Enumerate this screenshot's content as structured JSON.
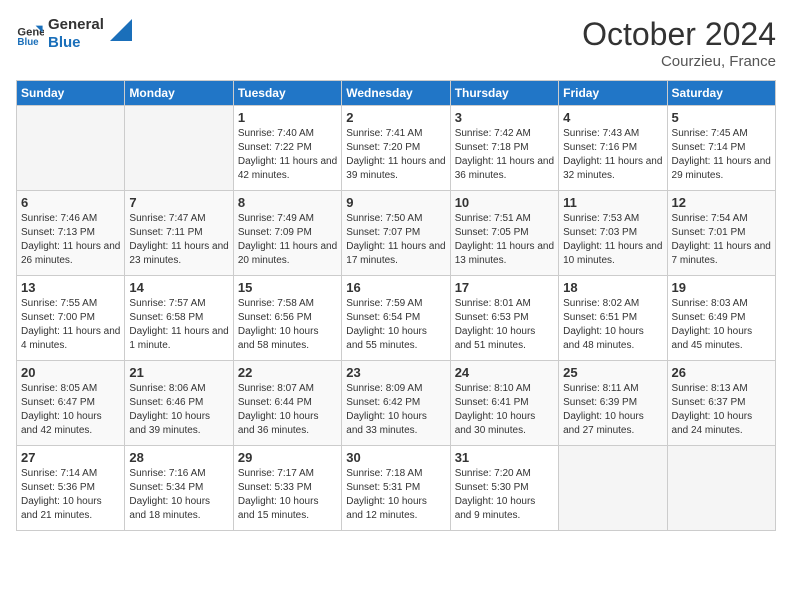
{
  "logo": {
    "line1": "General",
    "line2": "Blue"
  },
  "title": "October 2024",
  "location": "Courzieu, France",
  "weekdays": [
    "Sunday",
    "Monday",
    "Tuesday",
    "Wednesday",
    "Thursday",
    "Friday",
    "Saturday"
  ],
  "weeks": [
    [
      {
        "day": "",
        "sunrise": "",
        "sunset": "",
        "daylight": ""
      },
      {
        "day": "",
        "sunrise": "",
        "sunset": "",
        "daylight": ""
      },
      {
        "day": "1",
        "sunrise": "Sunrise: 7:40 AM",
        "sunset": "Sunset: 7:22 PM",
        "daylight": "Daylight: 11 hours and 42 minutes."
      },
      {
        "day": "2",
        "sunrise": "Sunrise: 7:41 AM",
        "sunset": "Sunset: 7:20 PM",
        "daylight": "Daylight: 11 hours and 39 minutes."
      },
      {
        "day": "3",
        "sunrise": "Sunrise: 7:42 AM",
        "sunset": "Sunset: 7:18 PM",
        "daylight": "Daylight: 11 hours and 36 minutes."
      },
      {
        "day": "4",
        "sunrise": "Sunrise: 7:43 AM",
        "sunset": "Sunset: 7:16 PM",
        "daylight": "Daylight: 11 hours and 32 minutes."
      },
      {
        "day": "5",
        "sunrise": "Sunrise: 7:45 AM",
        "sunset": "Sunset: 7:14 PM",
        "daylight": "Daylight: 11 hours and 29 minutes."
      }
    ],
    [
      {
        "day": "6",
        "sunrise": "Sunrise: 7:46 AM",
        "sunset": "Sunset: 7:13 PM",
        "daylight": "Daylight: 11 hours and 26 minutes."
      },
      {
        "day": "7",
        "sunrise": "Sunrise: 7:47 AM",
        "sunset": "Sunset: 7:11 PM",
        "daylight": "Daylight: 11 hours and 23 minutes."
      },
      {
        "day": "8",
        "sunrise": "Sunrise: 7:49 AM",
        "sunset": "Sunset: 7:09 PM",
        "daylight": "Daylight: 11 hours and 20 minutes."
      },
      {
        "day": "9",
        "sunrise": "Sunrise: 7:50 AM",
        "sunset": "Sunset: 7:07 PM",
        "daylight": "Daylight: 11 hours and 17 minutes."
      },
      {
        "day": "10",
        "sunrise": "Sunrise: 7:51 AM",
        "sunset": "Sunset: 7:05 PM",
        "daylight": "Daylight: 11 hours and 13 minutes."
      },
      {
        "day": "11",
        "sunrise": "Sunrise: 7:53 AM",
        "sunset": "Sunset: 7:03 PM",
        "daylight": "Daylight: 11 hours and 10 minutes."
      },
      {
        "day": "12",
        "sunrise": "Sunrise: 7:54 AM",
        "sunset": "Sunset: 7:01 PM",
        "daylight": "Daylight: 11 hours and 7 minutes."
      }
    ],
    [
      {
        "day": "13",
        "sunrise": "Sunrise: 7:55 AM",
        "sunset": "Sunset: 7:00 PM",
        "daylight": "Daylight: 11 hours and 4 minutes."
      },
      {
        "day": "14",
        "sunrise": "Sunrise: 7:57 AM",
        "sunset": "Sunset: 6:58 PM",
        "daylight": "Daylight: 11 hours and 1 minute."
      },
      {
        "day": "15",
        "sunrise": "Sunrise: 7:58 AM",
        "sunset": "Sunset: 6:56 PM",
        "daylight": "Daylight: 10 hours and 58 minutes."
      },
      {
        "day": "16",
        "sunrise": "Sunrise: 7:59 AM",
        "sunset": "Sunset: 6:54 PM",
        "daylight": "Daylight: 10 hours and 55 minutes."
      },
      {
        "day": "17",
        "sunrise": "Sunrise: 8:01 AM",
        "sunset": "Sunset: 6:53 PM",
        "daylight": "Daylight: 10 hours and 51 minutes."
      },
      {
        "day": "18",
        "sunrise": "Sunrise: 8:02 AM",
        "sunset": "Sunset: 6:51 PM",
        "daylight": "Daylight: 10 hours and 48 minutes."
      },
      {
        "day": "19",
        "sunrise": "Sunrise: 8:03 AM",
        "sunset": "Sunset: 6:49 PM",
        "daylight": "Daylight: 10 hours and 45 minutes."
      }
    ],
    [
      {
        "day": "20",
        "sunrise": "Sunrise: 8:05 AM",
        "sunset": "Sunset: 6:47 PM",
        "daylight": "Daylight: 10 hours and 42 minutes."
      },
      {
        "day": "21",
        "sunrise": "Sunrise: 8:06 AM",
        "sunset": "Sunset: 6:46 PM",
        "daylight": "Daylight: 10 hours and 39 minutes."
      },
      {
        "day": "22",
        "sunrise": "Sunrise: 8:07 AM",
        "sunset": "Sunset: 6:44 PM",
        "daylight": "Daylight: 10 hours and 36 minutes."
      },
      {
        "day": "23",
        "sunrise": "Sunrise: 8:09 AM",
        "sunset": "Sunset: 6:42 PM",
        "daylight": "Daylight: 10 hours and 33 minutes."
      },
      {
        "day": "24",
        "sunrise": "Sunrise: 8:10 AM",
        "sunset": "Sunset: 6:41 PM",
        "daylight": "Daylight: 10 hours and 30 minutes."
      },
      {
        "day": "25",
        "sunrise": "Sunrise: 8:11 AM",
        "sunset": "Sunset: 6:39 PM",
        "daylight": "Daylight: 10 hours and 27 minutes."
      },
      {
        "day": "26",
        "sunrise": "Sunrise: 8:13 AM",
        "sunset": "Sunset: 6:37 PM",
        "daylight": "Daylight: 10 hours and 24 minutes."
      }
    ],
    [
      {
        "day": "27",
        "sunrise": "Sunrise: 7:14 AM",
        "sunset": "Sunset: 5:36 PM",
        "daylight": "Daylight: 10 hours and 21 minutes."
      },
      {
        "day": "28",
        "sunrise": "Sunrise: 7:16 AM",
        "sunset": "Sunset: 5:34 PM",
        "daylight": "Daylight: 10 hours and 18 minutes."
      },
      {
        "day": "29",
        "sunrise": "Sunrise: 7:17 AM",
        "sunset": "Sunset: 5:33 PM",
        "daylight": "Daylight: 10 hours and 15 minutes."
      },
      {
        "day": "30",
        "sunrise": "Sunrise: 7:18 AM",
        "sunset": "Sunset: 5:31 PM",
        "daylight": "Daylight: 10 hours and 12 minutes."
      },
      {
        "day": "31",
        "sunrise": "Sunrise: 7:20 AM",
        "sunset": "Sunset: 5:30 PM",
        "daylight": "Daylight: 10 hours and 9 minutes."
      },
      {
        "day": "",
        "sunrise": "",
        "sunset": "",
        "daylight": ""
      },
      {
        "day": "",
        "sunrise": "",
        "sunset": "",
        "daylight": ""
      }
    ]
  ]
}
